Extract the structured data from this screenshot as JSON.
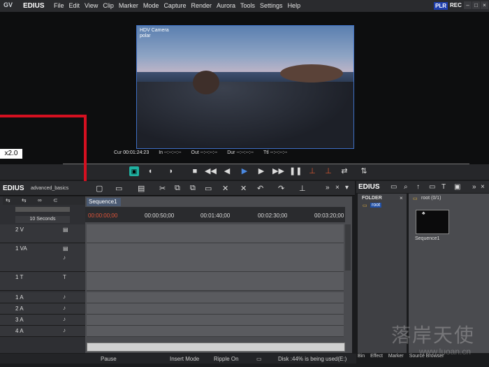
{
  "app": {
    "name": "EDIUS",
    "logo": "GV"
  },
  "menu": [
    "File",
    "Edit",
    "View",
    "Clip",
    "Marker",
    "Mode",
    "Capture",
    "Render",
    "Aurora",
    "Tools",
    "Settings",
    "Help"
  ],
  "indicators": {
    "plr": "PLR",
    "rec": "REC"
  },
  "player": {
    "camera_label": "HDV Camera",
    "sub_label": "polar",
    "zoom": "x2.0",
    "timecodes": [
      {
        "label": "Cur",
        "value": "00:01:24:23"
      },
      {
        "label": "In",
        "value": "--:--:--:--"
      },
      {
        "label": "Out",
        "value": "--:--:--:--"
      },
      {
        "label": "Dur",
        "value": "--:--:--:--"
      },
      {
        "label": "Ttl",
        "value": "--:--:--:--"
      }
    ]
  },
  "timeline": {
    "app_label": "EDIUS",
    "project": "advanced_basics",
    "sequence_tab": "Sequence1",
    "scale": "10 Seconds",
    "ruler": [
      "00:00:00;00",
      "00:00:50;00",
      "00:01:40;00",
      "00:02:30;00",
      "00:03:20;00"
    ],
    "tracks": [
      {
        "name": "2 V"
      },
      {
        "name": "1 VA"
      },
      {
        "name": "1 T"
      },
      {
        "name": "1 A"
      },
      {
        "name": "2 A"
      },
      {
        "name": "3 A"
      },
      {
        "name": "4 A"
      }
    ]
  },
  "bin": {
    "app_label": "EDIUS",
    "folder_title": "FOLDER",
    "root": "root",
    "bin_title": "root (0/1)",
    "clip": "Sequence1",
    "tabs": [
      "Bin",
      "Effect",
      "Marker",
      "Source Browser"
    ]
  },
  "status": {
    "state": "Pause",
    "mode": "Insert Mode",
    "ripple": "Ripple On",
    "disk": "Disk :44% is being used(E:)"
  },
  "watermark": {
    "text": "落岸天使",
    "url": "www.luoan.cn"
  },
  "colors": {
    "accent": "#3e6fc4",
    "highlight": "#d41020"
  }
}
